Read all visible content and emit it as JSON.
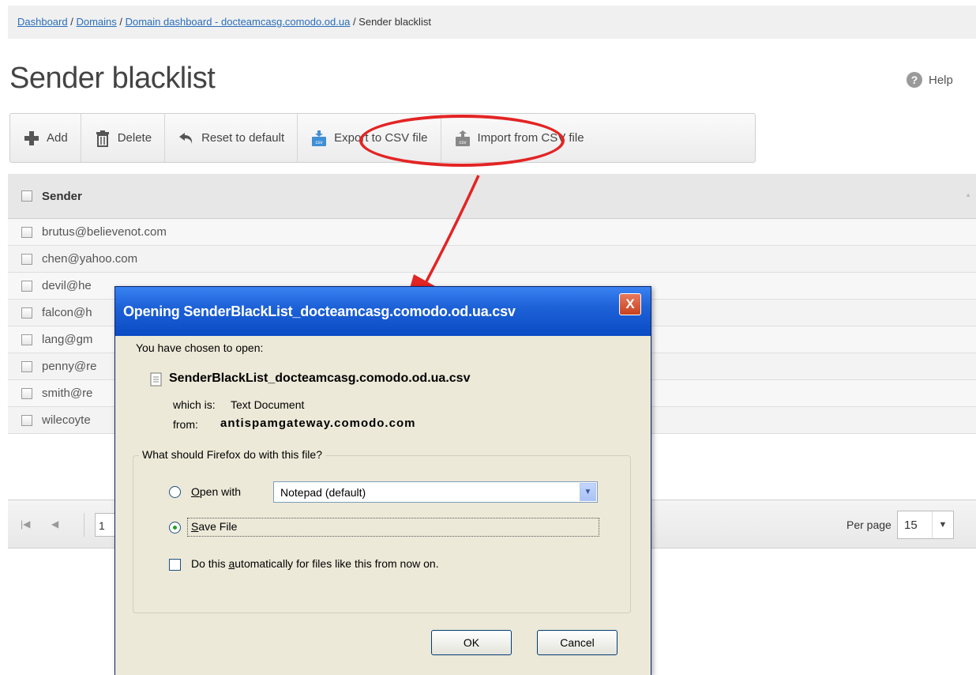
{
  "breadcrumb": {
    "items": [
      "Dashboard",
      "Domains",
      "Domain dashboard - docteamcasg.comodo.od.ua"
    ],
    "separator": " / ",
    "current": "Sender blacklist"
  },
  "page": {
    "title": "Sender blacklist",
    "help_label": "Help",
    "help_icon": "?"
  },
  "toolbar": {
    "buttons": [
      {
        "label": "Add",
        "icon": "plus-icon"
      },
      {
        "label": "Delete",
        "icon": "trash-icon"
      },
      {
        "label": "Reset to default",
        "icon": "undo-icon"
      },
      {
        "label": "Export to CSV file",
        "icon": "csv-export-icon"
      },
      {
        "label": "Import from CSV file",
        "icon": "csv-import-icon"
      }
    ]
  },
  "grid": {
    "column": "Sender",
    "rows": [
      "brutus@believenot.com",
      "chen@yahoo.com",
      "devil@he",
      "falcon@h",
      "lang@gm",
      "penny@re",
      "smith@re",
      "wilecoyte"
    ]
  },
  "pager": {
    "page": "1",
    "per_page_label": "Per page",
    "per_page_value": "15"
  },
  "dialog": {
    "title": "Opening SenderBlackList_docteamcasg.comodo.od.ua.csv",
    "close": "X",
    "chosen_label": "You have chosen to open:",
    "filename": "SenderBlackList_docteamcasg.comodo.od.ua.csv",
    "which_is_label": "which is:",
    "which_is_value": "Text Document",
    "from_label": "from:",
    "from_value": "antispamgateway.comodo.com",
    "question": "What should Firefox do with this file?",
    "open_with_pre": "",
    "open_with_key": "O",
    "open_with_rest": "pen with",
    "open_with_app": "Notepad (default)",
    "save_key": "S",
    "save_rest": "ave File",
    "auto_pre": "Do this ",
    "auto_key": "a",
    "auto_rest": "utomatically for files like this from now on.",
    "ok": "OK",
    "cancel": "Cancel",
    "selected_option": "Save File"
  },
  "colors": {
    "link": "#2a6ebb",
    "callout": "#e32424",
    "xp_title": "#0a4bc4",
    "xp_face": "#ece9d8"
  }
}
